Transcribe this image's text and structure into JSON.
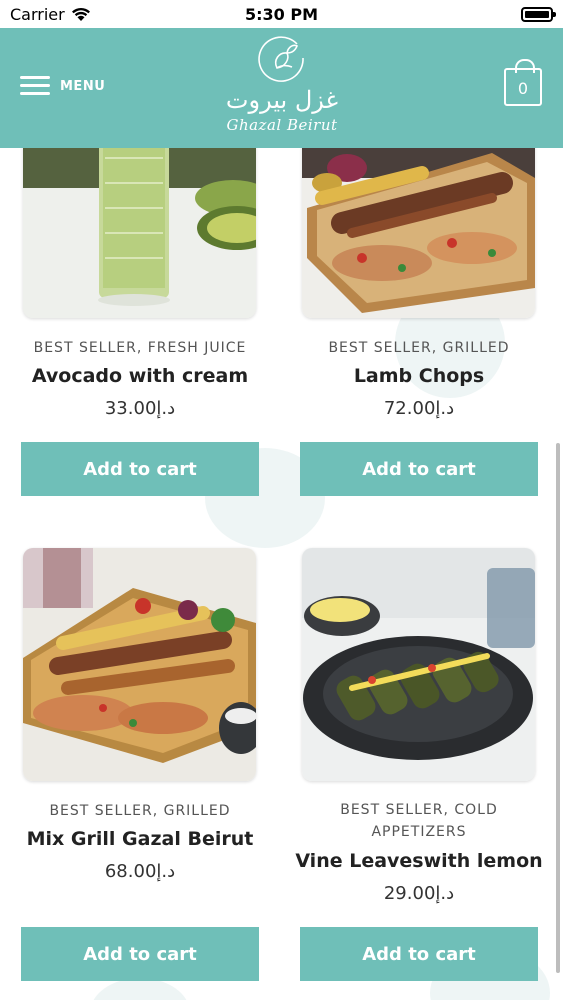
{
  "status_bar": {
    "carrier": "Carrier",
    "time": "5:30 PM"
  },
  "header": {
    "menu_label": "MENU",
    "logo_arabic": "غزل بيروت",
    "logo_latin": "Ghazal Beirut",
    "cart_count": "0",
    "colors": {
      "brand": "#6fbfb8"
    }
  },
  "products": [
    {
      "categories": "BEST SELLER, FRESH JUICE",
      "name": "Avocado with cream",
      "price": "33.00د.إ",
      "button": "Add to cart"
    },
    {
      "categories": "BEST SELLER, GRILLED",
      "name": "Lamb Chops",
      "price": "72.00د.إ",
      "button": "Add to cart"
    },
    {
      "categories": "BEST SELLER, GRILLED",
      "name": "Mix Grill Gazal Beirut",
      "price": "68.00د.إ",
      "button": "Add to cart"
    },
    {
      "categories": "BEST SELLER, COLD APPETIZERS",
      "name": "Vine Leaveswith lemon",
      "price": "29.00د.إ",
      "button": "Add to cart"
    }
  ]
}
